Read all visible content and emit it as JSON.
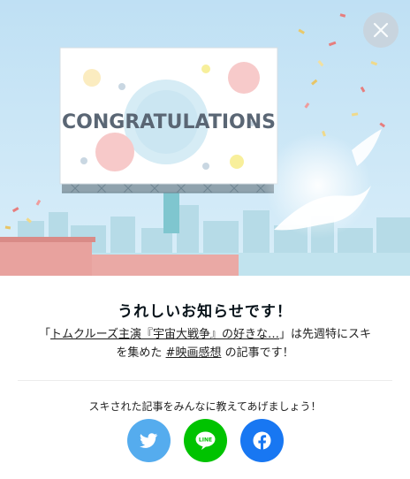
{
  "billboard": {
    "text": "CONGRATULATIONS"
  },
  "close_button": {
    "icon": "close-icon"
  },
  "notice": {
    "title": "うれしいお知らせです！",
    "quote_open": "「",
    "article_link": "トムクルーズ主演『宇宙大戦争』の好きな…",
    "text_after_link": "」は先週特にスキを集めた",
    "hashtag_link": "#映画感想",
    "text_end": "の記事です！"
  },
  "share": {
    "prompt": "スキされた記事をみんなに教えてあげましょう！",
    "buttons": [
      {
        "name": "twitter",
        "icon": "twitter-icon",
        "color": "#55acee"
      },
      {
        "name": "line",
        "icon": "line-icon",
        "label": "LINE",
        "color": "#00c300"
      },
      {
        "name": "facebook",
        "icon": "facebook-icon",
        "color": "#1877f2"
      }
    ]
  },
  "colors": {
    "sky": "#c9e6f7",
    "billboard_text": "#5a6674",
    "ground": "#e8a29e"
  }
}
